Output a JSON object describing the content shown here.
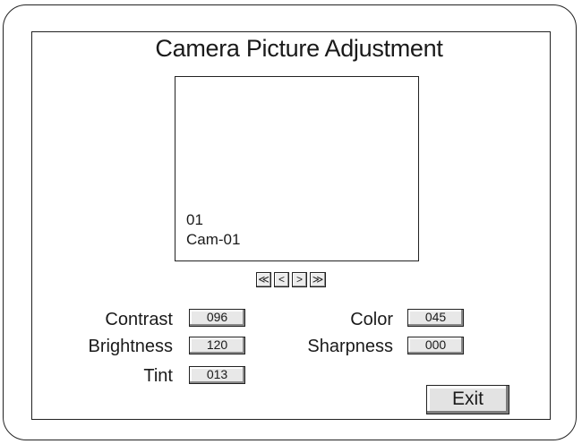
{
  "title": "Camera Picture Adjustment",
  "preview": {
    "camera_number": "01",
    "camera_name": "Cam-01"
  },
  "nav": {
    "first_symbol": "≪",
    "prev_symbol": "<",
    "next_symbol": ">",
    "last_symbol": "≫"
  },
  "settings": {
    "contrast": {
      "label": "Contrast",
      "value": "096"
    },
    "brightness": {
      "label": "Brightness",
      "value": "120"
    },
    "tint": {
      "label": "Tint",
      "value": "013"
    },
    "color": {
      "label": "Color",
      "value": "045"
    },
    "sharpness": {
      "label": "Sharpness",
      "value": "000"
    }
  },
  "exit_label": "Exit"
}
